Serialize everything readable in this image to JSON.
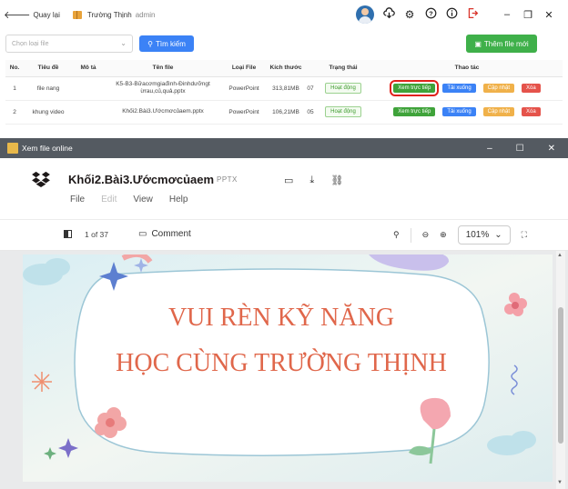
{
  "topbar": {
    "back_label": "Quay lại",
    "school_name": "Trường Thịnh",
    "role": "admin",
    "icons": [
      "avatar",
      "cloud-download-icon",
      "gear-icon",
      "help-icon",
      "info-icon",
      "logout-icon"
    ],
    "window_controls": [
      "minimize-icon",
      "restore-icon",
      "close-icon"
    ]
  },
  "toolbar": {
    "select_placeholder": "Chọn loại file",
    "search_label": "Tìm kiếm",
    "add_label": "Thêm file mới"
  },
  "table": {
    "headers": [
      "No.",
      "Tiêu đề",
      "Mô tả",
      "Tên file",
      "Loại File",
      "Kích thước",
      "",
      "Trạng thái",
      "Thao tác"
    ],
    "rows": [
      {
        "no": "1",
        "title": "file nang",
        "desc": "",
        "filename_1": "K5-B3-Bữacơmgiađình-Đinhdưỡngt",
        "filename_2": "ừrau,củ,quả.pptx",
        "type": "PowerPoint",
        "size": "313,81MB",
        "extra": "07",
        "status": "Hoạt động"
      },
      {
        "no": "2",
        "title": "khung video",
        "desc": "",
        "filename_1": "Khối2.Bài3.Ướcmơcủaem.pptx",
        "filename_2": "",
        "type": "PowerPoint",
        "size": "106,21MB",
        "extra": "05",
        "status": "Hoạt động"
      }
    ],
    "actions": {
      "view": "Xem trực tiếp",
      "download": "Tải xuống",
      "update": "Cập nhật",
      "delete": "Xóa"
    }
  },
  "viewer": {
    "window_title": "Xem file online",
    "doc_title": "Khối2.Bài3.Ướcmơcủaem",
    "doc_type": "PPTX",
    "menu": [
      "File",
      "Edit",
      "View",
      "Help"
    ],
    "page_info": "1 of 37",
    "comment_label": "Comment",
    "zoom": "101%",
    "slide_line_1": "VUI RÈN KỸ NĂNG",
    "slide_line_2": "HỌC CÙNG TRƯỜNG THỊNH"
  },
  "colors": {
    "primary_blue": "#3b82f6",
    "green": "#3fb04a",
    "orange": "#f0b14a",
    "red": "#e5534b",
    "slide_text": "#e0674b",
    "titlebar": "#545a61"
  }
}
